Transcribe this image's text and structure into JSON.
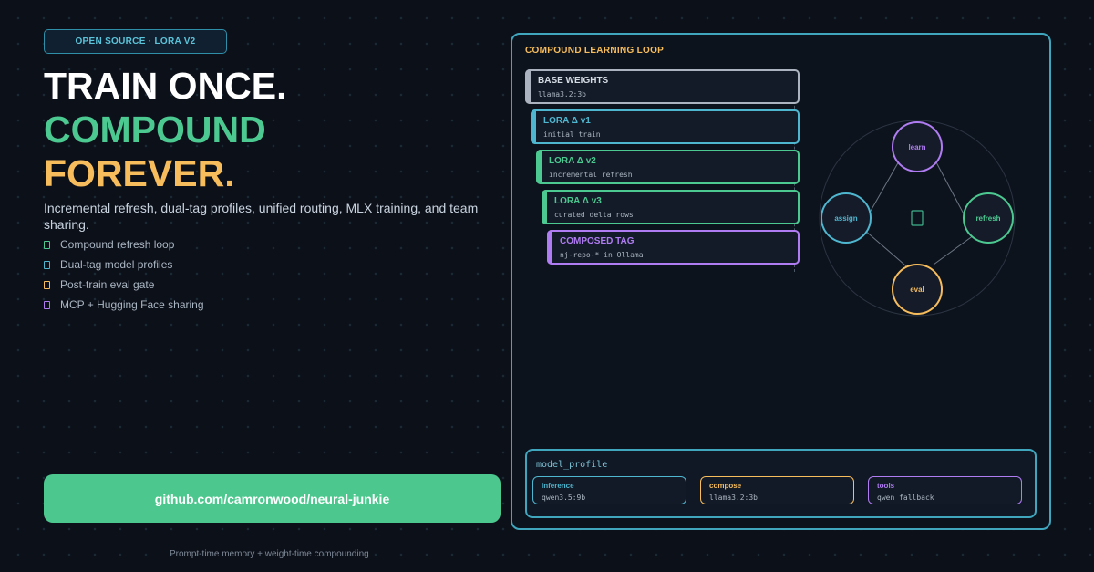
{
  "badge": "OPEN SOURCE · LORA V2",
  "headline": {
    "line1": "TRAIN ONCE.",
    "line2": "COMPOUND",
    "line3": "FOREVER."
  },
  "description": "Incremental refresh, dual-tag profiles, unified routing, MLX training, and team sharing.",
  "features": [
    {
      "label": "Compound refresh loop",
      "color": "#4cc990"
    },
    {
      "label": "Dual-tag model profiles",
      "color": "#4fb6cf"
    },
    {
      "label": "Post-train eval gate",
      "color": "#f7bd5c"
    },
    {
      "label": "MCP + Hugging Face sharing",
      "color": "#b07cf2"
    }
  ],
  "cta": "github.com/camronwood/neural-junkie",
  "footer": "Prompt-time memory + weight-time compounding",
  "panel": {
    "title": "COMPOUND LEARNING LOOP",
    "stack": [
      {
        "title": "BASE WEIGHTS",
        "subtitle": "llama3.2:3b",
        "color": "#aab3bf"
      },
      {
        "title": "LORA Δ v1",
        "subtitle": "initial train",
        "color": "#4fb6cf"
      },
      {
        "title": "LORA Δ v2",
        "subtitle": "incremental refresh",
        "color": "#4cc990"
      },
      {
        "title": "LORA Δ v3",
        "subtitle": "curated delta rows",
        "color": "#4cc990"
      },
      {
        "title": "COMPOSED TAG",
        "subtitle": "nj-repo-* in Ollama",
        "color": "#b07cf2"
      }
    ],
    "loop": {
      "nodes": [
        {
          "label": "learn",
          "color": "#b07cf2"
        },
        {
          "label": "refresh",
          "color": "#4cc990"
        },
        {
          "label": "eval",
          "color": "#f7bd5c"
        },
        {
          "label": "assign",
          "color": "#4fb6cf"
        }
      ],
      "center_icon": "refresh-cycle-icon"
    },
    "profile": {
      "title": "model_profile",
      "chips": [
        {
          "key": "inference",
          "value": "qwen3.5:9b",
          "color": "#4fb6cf"
        },
        {
          "key": "compose",
          "value": "llama3.2:3b",
          "color": "#f7bd5c"
        },
        {
          "key": "tools",
          "value": "qwen fallback",
          "color": "#b07cf2"
        }
      ]
    }
  }
}
